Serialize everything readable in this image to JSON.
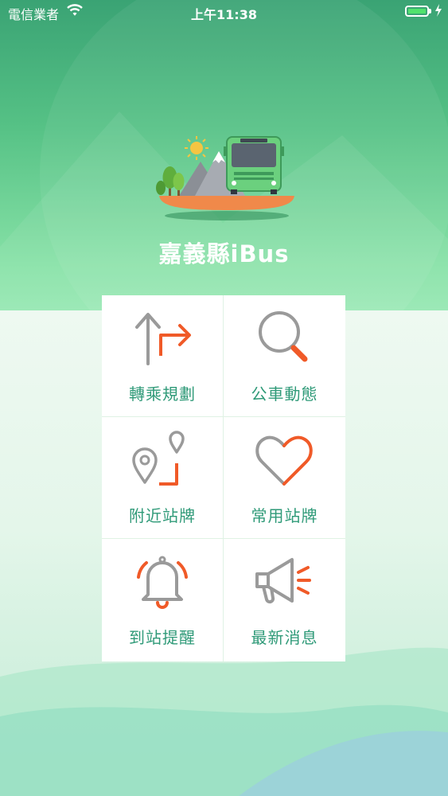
{
  "status_bar": {
    "carrier": "電信業者",
    "time": "上午11:38",
    "icons": [
      "wifi-icon",
      "battery-icon",
      "charging-bolt-icon"
    ]
  },
  "app": {
    "title": "嘉義縣iBus",
    "illustration": "bus-mountain-illustration"
  },
  "menu": {
    "items": [
      {
        "label": "轉乘規劃",
        "icon": "transfer-route-icon"
      },
      {
        "label": "公車動態",
        "icon": "search-magnifier-icon"
      },
      {
        "label": "附近站牌",
        "icon": "nearby-stops-pin-icon"
      },
      {
        "label": "常用站牌",
        "icon": "heart-favorite-icon"
      },
      {
        "label": "到站提醒",
        "icon": "bell-alert-icon"
      },
      {
        "label": "最新消息",
        "icon": "megaphone-news-icon"
      }
    ]
  },
  "colors": {
    "header_green": "#4dbb80",
    "label_teal": "#2f9a78",
    "icon_gray": "#9a9a9a",
    "icon_orange": "#f05a28",
    "battery_green": "#51e26d"
  }
}
